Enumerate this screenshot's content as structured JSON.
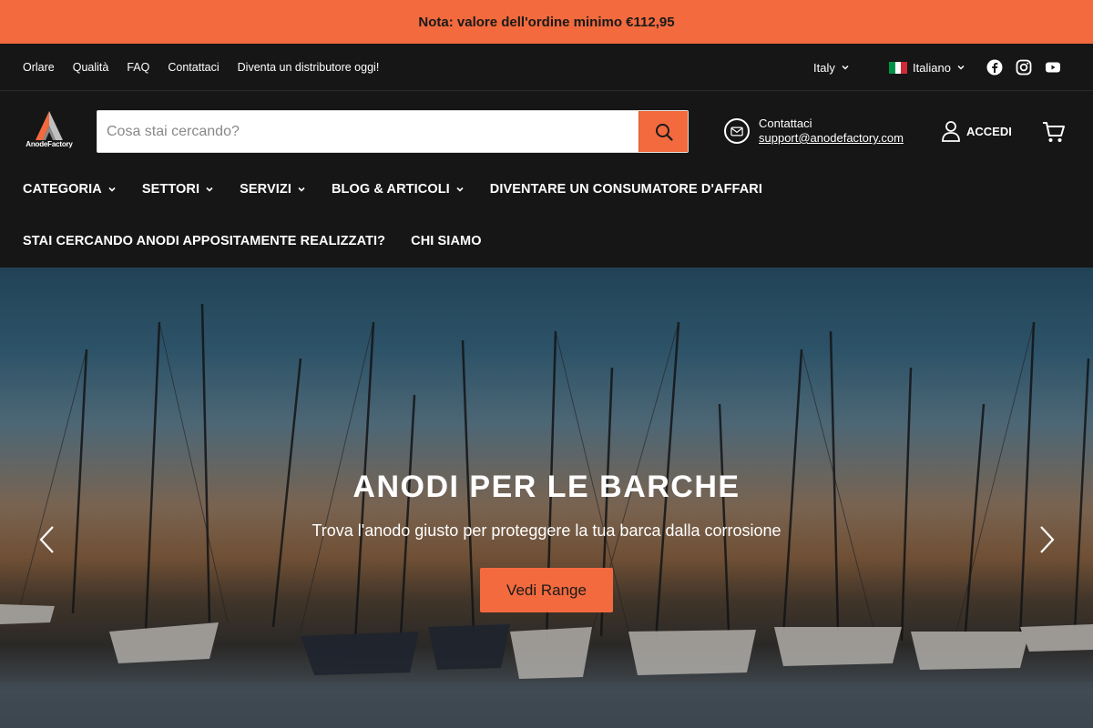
{
  "announcement": "Nota: valore dell'ordine minimo €112,95",
  "utility": {
    "links": [
      "Orlare",
      "Qualità",
      "FAQ",
      "Contattaci",
      "Diventa un distributore oggi!"
    ],
    "country": "Italy",
    "language": "Italiano",
    "social_icons": [
      "facebook-icon",
      "instagram-icon",
      "youtube-icon"
    ]
  },
  "header": {
    "logo_text": "AnodeFactory",
    "search_placeholder": "Cosa stai cercando?",
    "contact_label": "Contattaci",
    "contact_email": "support@anodefactory.com",
    "login_label": "ACCEDI"
  },
  "nav": {
    "row1": [
      {
        "label": "CATEGORIA",
        "dropdown": true
      },
      {
        "label": "SETTORI",
        "dropdown": true
      },
      {
        "label": "SERVIZI",
        "dropdown": true
      },
      {
        "label": "BLOG & ARTICOLI",
        "dropdown": true
      },
      {
        "label": "DIVENTARE UN CONSUMATORE D'AFFARI",
        "dropdown": false
      }
    ],
    "row2": [
      {
        "label": "STAI CERCANDO ANODI APPOSITAMENTE REALIZZATI?",
        "dropdown": false
      },
      {
        "label": "CHI SIAMO",
        "dropdown": false
      }
    ]
  },
  "hero": {
    "title": "ANODI PER LE BARCHE",
    "subtitle": "Trova l'anodo giusto per proteggere la tua barca dalla corrosione",
    "button_label": "Vedi Range"
  },
  "colors": {
    "accent": "#f26a3d",
    "header_bg": "#161616"
  }
}
